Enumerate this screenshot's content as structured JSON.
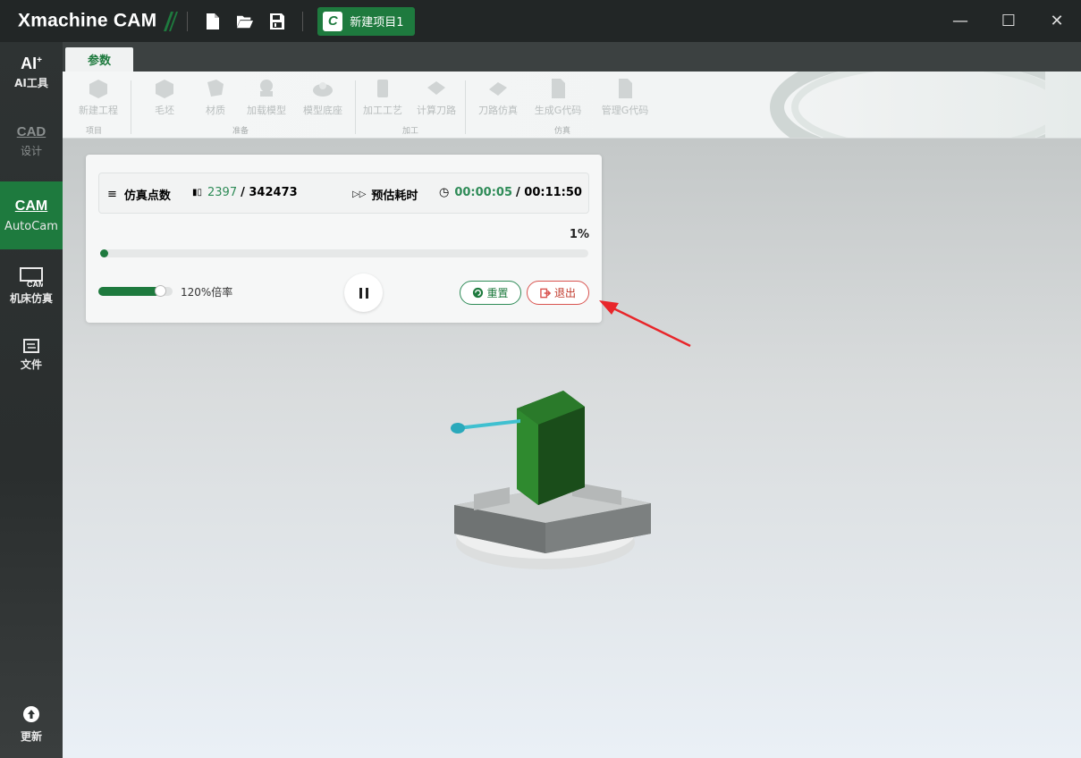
{
  "app": {
    "title": "Xmachine CAM",
    "project_tab": {
      "letter": "C",
      "label": "新建项目1"
    },
    "toolbar_icons": [
      "new-file-icon",
      "open-folder-icon",
      "save-icon"
    ],
    "window_controls": {
      "minimize": "—",
      "maximize": "☐",
      "close": "✕"
    }
  },
  "sidebar": {
    "items": [
      {
        "glyph": "AI",
        "sup": "+",
        "label": "AI工具"
      },
      {
        "glyph": "CAD",
        "label": "设计"
      },
      {
        "glyph": "CAM",
        "label": "AutoCam"
      },
      {
        "glyph": "CAM",
        "label": "机床仿真"
      },
      {
        "glyph": "⇆",
        "label": "文件"
      },
      {
        "glyph": "↑",
        "label": "更新"
      }
    ]
  },
  "ribbon": {
    "tab": "参数",
    "buttons": [
      "新建工程",
      "毛坯",
      "材质",
      "加载模型",
      "模型底座",
      "加工工艺",
      "计算刀路",
      "刀路仿真",
      "生成G代码",
      "管理G代码"
    ],
    "groups": [
      "项目",
      "准备",
      "加工",
      "仿真"
    ]
  },
  "simulation": {
    "points_label": "仿真点数",
    "points_current": "2397",
    "points_total": "/ 342473",
    "time_label": "预估耗时",
    "time_elapsed": "00:00:05",
    "time_total": "/ 00:11:50",
    "progress_text": "1%",
    "progress_value": 0.01,
    "speed_label": "120%倍率",
    "speed_value": 0.83,
    "reset_label": "重置",
    "exit_label": "退出"
  },
  "colors": {
    "accent": "#1e7a3e",
    "accent_text": "#2e8b57",
    "exit": "#d9534f",
    "annotation_arrow": "#e8262a"
  }
}
